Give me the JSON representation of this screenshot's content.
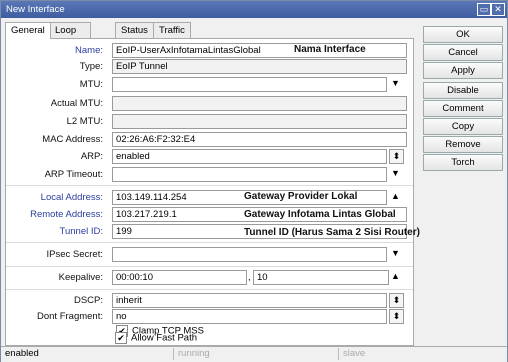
{
  "window": {
    "title": "New Interface",
    "minimize_glyph": "▭",
    "close_glyph": "✕"
  },
  "tabs": [
    {
      "label": "General"
    },
    {
      "label": "Loop Protect"
    },
    {
      "label": "Status"
    },
    {
      "label": "Traffic"
    }
  ],
  "fields": {
    "name": {
      "label": "Name:",
      "value": "EoIP-UserAxInfotamaLintasGlobal",
      "note": "Nama Interface"
    },
    "type": {
      "label": "Type:",
      "value": "EoIP Tunnel"
    },
    "mtu": {
      "label": "MTU:",
      "value": ""
    },
    "actual_mtu": {
      "label": "Actual MTU:",
      "value": ""
    },
    "l2_mtu": {
      "label": "L2 MTU:",
      "value": ""
    },
    "mac_address": {
      "label": "MAC Address:",
      "value": "02:26:A6:F2:32:E4"
    },
    "arp": {
      "label": "ARP:",
      "value": "enabled"
    },
    "arp_timeout": {
      "label": "ARP Timeout:",
      "value": ""
    },
    "local_address": {
      "label": "Local Address:",
      "value": "103.149.114.254",
      "note": "Gateway Provider Lokal"
    },
    "remote_address": {
      "label": "Remote Address:",
      "value": "103.217.219.1",
      "note": "Gateway Infotama Lintas Global"
    },
    "tunnel_id": {
      "label": "Tunnel ID:",
      "value": "199",
      "note": "Tunnel ID (Harus Sama 2 Sisi Router)"
    },
    "ipsec_secret": {
      "label": "IPsec Secret:",
      "value": ""
    },
    "keepalive": {
      "label": "Keepalive:",
      "value": "00:00:10",
      "value2": "10",
      "sep": ","
    },
    "dscp": {
      "label": "DSCP:",
      "value": "inherit"
    },
    "dont_fragment": {
      "label": "Dont Fragment:",
      "value": "no"
    }
  },
  "checkboxes": {
    "clamp_tcp_mss": {
      "label": "Clamp TCP MSS",
      "checked": true,
      "mark": "✔"
    },
    "allow_fast_path": {
      "label": "Allow Fast Path",
      "checked": true,
      "mark": "✔"
    }
  },
  "buttons": {
    "ok": "OK",
    "cancel": "Cancel",
    "apply": "Apply",
    "disable": "Disable",
    "comment": "Comment",
    "copy": "Copy",
    "remove": "Remove",
    "torch": "Torch"
  },
  "icons": {
    "arrow_down": "▼",
    "arrow_up": "▲",
    "dropdown": "⬍"
  },
  "statusbar": {
    "state": "enabled",
    "running": "running",
    "slave": "slave"
  },
  "colors": {
    "titlebar": "#4a68aa",
    "label_blue": "#2a3e9c"
  }
}
